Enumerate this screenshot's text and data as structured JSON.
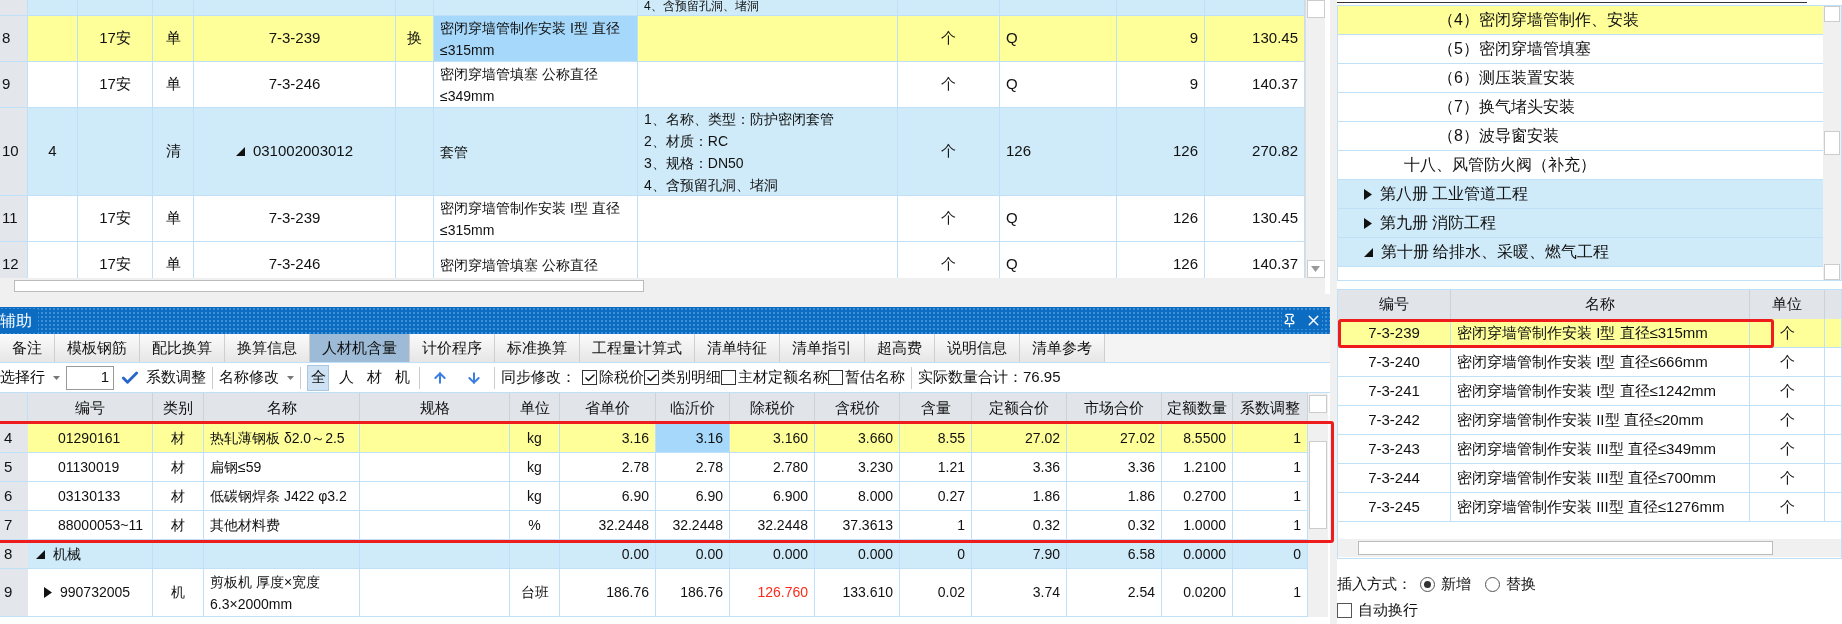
{
  "top_table": {
    "rows": [
      {
        "kind": "bill",
        "selected": false,
        "cells": [
          null,
          null,
          null,
          null,
          null,
          null,
          {
            "lines": [
              "4、含预留孔洞、堵洞"
            ]
          },
          null,
          null,
          null,
          null
        ]
      },
      {
        "row_header": "8",
        "kind": "quota",
        "selected": true,
        "cells": [
          null,
          "17安",
          "单",
          "7-3-239",
          "换",
          {
            "text": "密闭穿墙管制作安装 I型 直径≤315mm",
            "active": true
          },
          null,
          "个",
          "Q",
          "9",
          "130.45"
        ]
      },
      {
        "row_header": "9",
        "kind": "quota",
        "selected": false,
        "cells": [
          null,
          "17安",
          "单",
          "7-3-246",
          null,
          "密闭穿墙管填塞 公称直径≤349mm",
          null,
          "个",
          "Q",
          "9",
          "140.37"
        ]
      },
      {
        "row_header": "10",
        "kind": "bill",
        "selected": false,
        "cells": [
          "4",
          null,
          "清",
          {
            "text": "031002003012",
            "expanded": true
          },
          null,
          "套管",
          {
            "lines": [
              "1、名称、类型：防护密闭套管",
              "2、材质：RC",
              "3、规格：DN50",
              "4、含预留孔洞、堵洞"
            ]
          },
          "个",
          "126",
          "126",
          "270.82"
        ]
      },
      {
        "row_header": "11",
        "kind": "quota",
        "selected": false,
        "cells": [
          null,
          "17安",
          "单",
          "7-3-239",
          null,
          "密闭穿墙管制作安装 I型 直径≤315mm",
          null,
          "个",
          "Q",
          "126",
          "130.45"
        ]
      },
      {
        "row_header": "12",
        "kind": "quota",
        "selected": false,
        "cells": [
          null,
          "17安",
          "单",
          "7-3-246",
          null,
          "密闭穿墙管填塞 公称直径",
          null,
          "个",
          "Q",
          "126",
          "140.37"
        ]
      }
    ]
  },
  "panel": {
    "title": "辅助",
    "tabs": [
      {
        "label": "备注",
        "selected": false
      },
      {
        "label": "模板钢筋",
        "selected": false
      },
      {
        "label": "配比换算",
        "selected": false
      },
      {
        "label": "换算信息",
        "selected": false
      },
      {
        "label": "人材机含量",
        "selected": true
      },
      {
        "label": "计价程序",
        "selected": false
      },
      {
        "label": "标准换算",
        "selected": false
      },
      {
        "label": "工程量计算式",
        "selected": false
      },
      {
        "label": "清单特征",
        "selected": false
      },
      {
        "label": "清单指引",
        "selected": false
      },
      {
        "label": "超高费",
        "selected": false
      },
      {
        "label": "说明信息",
        "selected": false
      },
      {
        "label": "清单参考",
        "selected": false
      }
    ],
    "toolbar": {
      "row_select": "选择行",
      "row_value": "1",
      "coefficient_button": "系数调整",
      "rename_menu": "名称修改",
      "filters": [
        {
          "label": "全",
          "selected": true
        },
        {
          "label": "人",
          "selected": false
        },
        {
          "label": "材",
          "selected": false
        },
        {
          "label": "机",
          "selected": false
        }
      ],
      "sync_label": "同步修改：",
      "options": [
        {
          "label": "除税价",
          "checked": true
        },
        {
          "label": "类别明细",
          "checked": true
        },
        {
          "label": "主材定额名称",
          "checked": false
        },
        {
          "label": "暂估名称",
          "checked": false
        }
      ],
      "total": "实际数量合计：76.95"
    },
    "grid": {
      "columns": [
        "编号",
        "类别",
        "名称",
        "规格",
        "单位",
        "省单价",
        "临沂价",
        "除税价",
        "含税价",
        "含量",
        "定额合价",
        "市场合价",
        "定额数量",
        "系数调整"
      ],
      "rows": [
        {
          "row_header": "4",
          "kind": "item",
          "selected": true,
          "framed": true,
          "cells": [
            "01290161",
            "材",
            "热轧薄钢板 δ2.0～2.5",
            null,
            "kg",
            "3.16",
            {
              "text": "3.16",
              "active": true
            },
            "3.160",
            "3.660",
            "8.55",
            "27.02",
            "27.02",
            "8.5500",
            "1"
          ]
        },
        {
          "row_header": "5",
          "kind": "item",
          "selected": false,
          "framed": true,
          "cells": [
            "01130019",
            "材",
            "扁钢≤59",
            null,
            "kg",
            "2.78",
            "2.78",
            "2.780",
            "3.230",
            "1.21",
            "3.36",
            "3.36",
            "1.2100",
            "1"
          ]
        },
        {
          "row_header": "6",
          "kind": "item",
          "selected": false,
          "framed": true,
          "cells": [
            "03130133",
            "材",
            "低碳钢焊条 J422 φ3.2",
            null,
            "kg",
            "6.90",
            "6.90",
            "6.900",
            "8.000",
            "0.27",
            "1.86",
            "1.86",
            "0.2700",
            "1"
          ]
        },
        {
          "row_header": "7",
          "kind": "item",
          "selected": false,
          "framed": true,
          "cells": [
            "88000053~11",
            "材",
            "其他材料费",
            null,
            "%",
            "32.2448",
            "32.2448",
            "32.2448",
            "37.3613",
            "1",
            "0.32",
            "0.32",
            "1.0000",
            "1"
          ]
        },
        {
          "row_header": "8",
          "kind": "group",
          "selected": false,
          "framed": false,
          "cells": [
            {
              "text": "机械",
              "expanded": true
            },
            null,
            null,
            null,
            null,
            "0.00",
            "0.00",
            "0.000",
            "0.000",
            "0",
            "7.90",
            "6.58",
            "0.0000",
            "0"
          ]
        },
        {
          "row_header": "9",
          "kind": "item",
          "selected": false,
          "framed": false,
          "cells": [
            {
              "text": "990732005",
              "expanded": false
            },
            "机",
            "剪板机 厚度×宽度 6.3×2000mm",
            null,
            "台班",
            "186.76",
            "186.76",
            {
              "text": "126.760",
              "changed": true
            },
            "133.610",
            "0.02",
            "3.74",
            "2.54",
            "0.0200",
            "1"
          ]
        }
      ]
    }
  },
  "library": {
    "tree": [
      {
        "children": [
          {
            "children": [
              {
                "label": "（4）密闭穿墙管制作、安装",
                "selected": true
              },
              {
                "label": "（5）密闭穿墙管填塞",
                "selected": false
              },
              {
                "label": "（6）测压装置安装",
                "selected": false
              },
              {
                "label": "（7）换气堵头安装",
                "selected": false
              },
              {
                "label": "（8）波导窗安装",
                "selected": false
              }
            ]
          },
          {
            "label": "十八、风管防火阀（补充）",
            "selected": false
          }
        ]
      },
      {
        "label": "第八册 工业管道工程",
        "selected": false,
        "expanded": false
      },
      {
        "label": "第九册 消防工程",
        "selected": false,
        "expanded": false
      },
      {
        "label": "第十册 给排水、采暖、燃气工程",
        "selected": false,
        "expanded": true
      }
    ],
    "grid": {
      "columns": [
        "编号",
        "名称",
        "单位"
      ],
      "rows": [
        {
          "code": "7-3-239",
          "name": "密闭穿墙管制作安装 I型 直径≤315mm",
          "unit": "个",
          "selected": true,
          "framed": true
        },
        {
          "code": "7-3-240",
          "name": "密闭穿墙管制作安装 I型 直径≤666mm",
          "unit": "个",
          "selected": false,
          "framed": false
        },
        {
          "code": "7-3-241",
          "name": "密闭穿墙管制作安装 I型 直径≤1242mm",
          "unit": "个",
          "selected": false,
          "framed": false
        },
        {
          "code": "7-3-242",
          "name": "密闭穿墙管制作安装 II型 直径≤20mm",
          "unit": "个",
          "selected": false,
          "framed": false
        },
        {
          "code": "7-3-243",
          "name": "密闭穿墙管制作安装 III型 直径≤349mm",
          "unit": "个",
          "selected": false,
          "framed": false
        },
        {
          "code": "7-3-244",
          "name": "密闭穿墙管制作安装 III型 直径≤700mm",
          "unit": "个",
          "selected": false,
          "framed": false
        },
        {
          "code": "7-3-245",
          "name": "密闭穿墙管制作安装 III型 直径≤1276mm",
          "unit": "个",
          "selected": false,
          "framed": false
        }
      ]
    },
    "insert_mode": {
      "label": "插入方式：",
      "options": [
        {
          "label": "新增",
          "selected": true
        },
        {
          "label": "替换",
          "selected": false
        }
      ]
    },
    "auto_wrap": {
      "label": "自动换行",
      "checked": false
    }
  }
}
